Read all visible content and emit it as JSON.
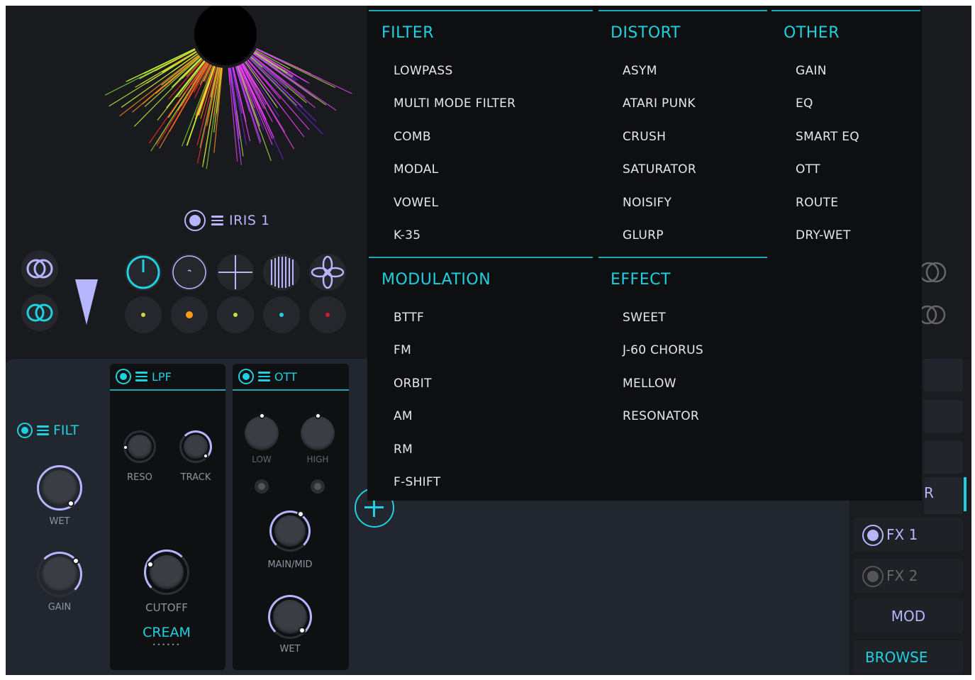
{
  "iris": {
    "title": "IRIS 1"
  },
  "lower_panel": {
    "filt": {
      "title": "FILT",
      "knobs": [
        "WET",
        "GAIN"
      ]
    },
    "lpf": {
      "title": "LPF",
      "knobs": [
        "RESO",
        "TRACK",
        "CUTOFF"
      ],
      "preset": "CREAM"
    },
    "ott": {
      "title": "OTT",
      "knobs": [
        "LOW",
        "HIGH",
        "MAIN/MID",
        "WET"
      ]
    }
  },
  "menu": {
    "sections": [
      {
        "title": "FILTER",
        "items": [
          "LOWPASS",
          "MULTI MODE FILTER",
          "COMB",
          "MODAL",
          "VOWEL",
          "K-35"
        ]
      },
      {
        "title": "DISTORT",
        "items": [
          "ASYM",
          "ATARI PUNK",
          "CRUSH",
          "SATURATOR",
          "NOISIFY",
          "GLURP"
        ]
      },
      {
        "title": "OTHER",
        "items": [
          "GAIN",
          "EQ",
          "SMART EQ",
          "OTT",
          "ROUTE",
          "DRY-WET"
        ]
      },
      {
        "title": "MODULATION",
        "items": [
          "BTTF",
          "FM",
          "ORBIT",
          "AM",
          "RM",
          "F-SHIFT"
        ]
      },
      {
        "title": "EFFECT",
        "items": [
          "SWEET",
          "J-60 CHORUS",
          "MELLOW",
          "RESONATOR"
        ]
      }
    ]
  },
  "sidebar": {
    "partial_label": "R",
    "fx1": "FX 1",
    "fx2": "FX 2",
    "mod": "MOD",
    "browse": "BROWSE"
  },
  "colors": {
    "accent_cyan": "#1fd1e0",
    "accent_lavender": "#b6b6ff",
    "background": "#181a1e",
    "menu_background": "#0e0f10"
  },
  "icons": {
    "iris_power": "power-toggle-icon",
    "menu": "hamburger-icon",
    "add": "plus-icon",
    "spread": "triangle-down-icon",
    "shapes": [
      "rings-icon",
      "rings-icon",
      "knob-icon",
      "spiral-icon",
      "crosshair-icon",
      "barcode-icon",
      "fan-icon"
    ]
  }
}
